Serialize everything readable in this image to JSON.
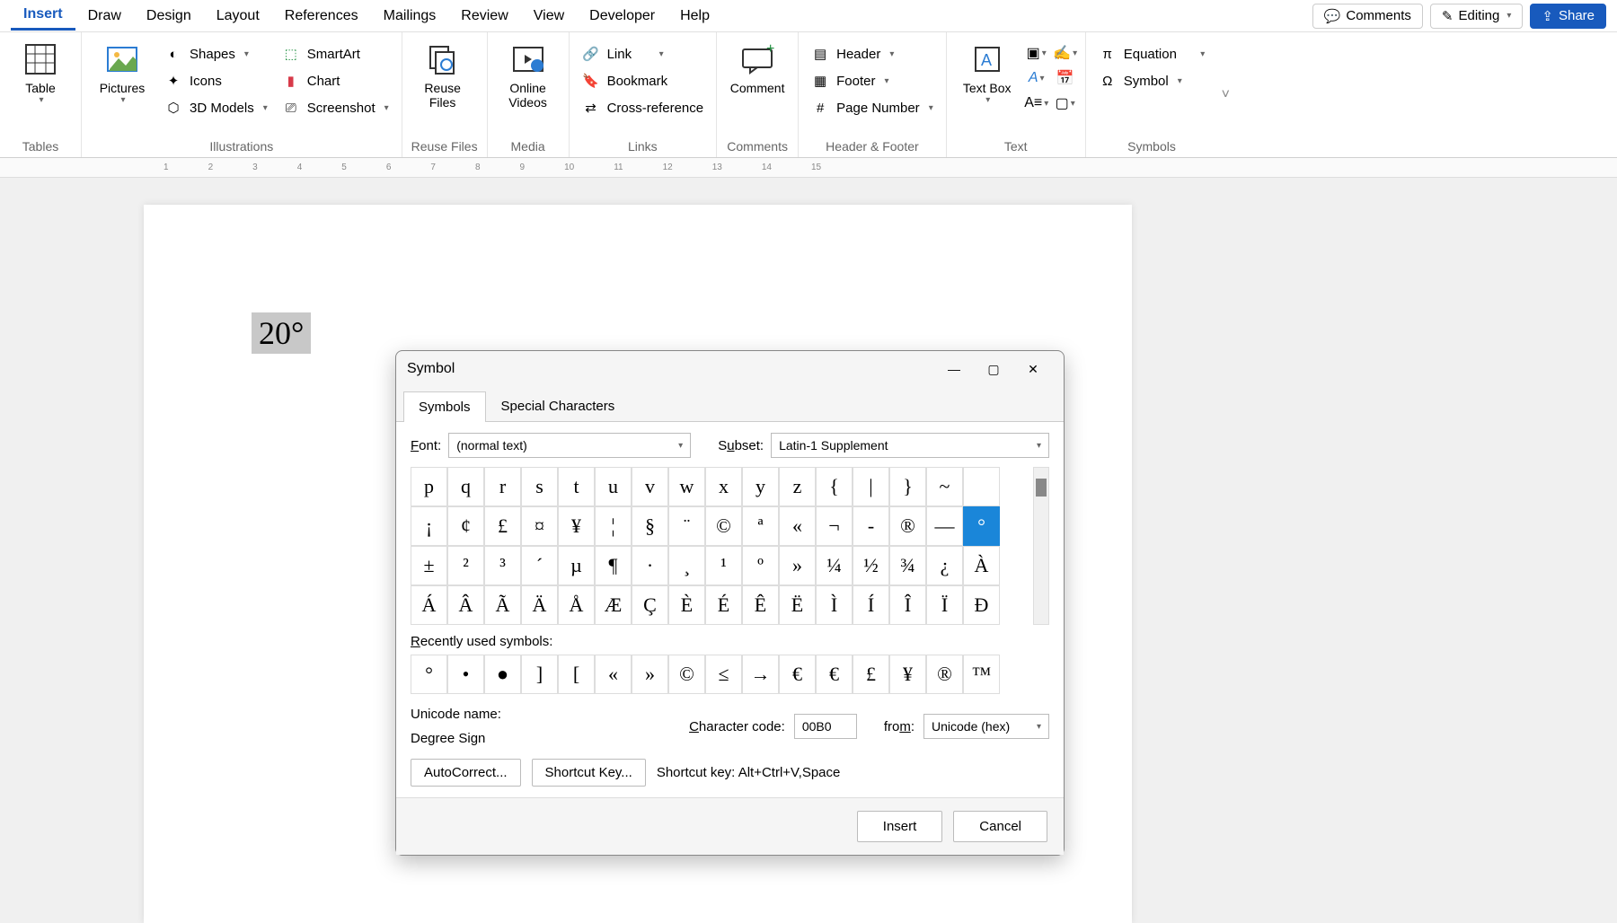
{
  "menubar": {
    "tabs": [
      "Insert",
      "Draw",
      "Design",
      "Layout",
      "References",
      "Mailings",
      "Review",
      "View",
      "Developer",
      "Help"
    ],
    "active": "Insert",
    "comments": "Comments",
    "editing": "Editing",
    "share": "Share"
  },
  "ribbon": {
    "tables": {
      "label": "Tables",
      "table": "Table"
    },
    "illustrations": {
      "label": "Illustrations",
      "pictures": "Pictures",
      "shapes": "Shapes",
      "icons": "Icons",
      "models": "3D Models",
      "smartart": "SmartArt",
      "chart": "Chart",
      "screenshot": "Screenshot"
    },
    "reuse": {
      "label": "Reuse Files",
      "btn": "Reuse Files"
    },
    "media": {
      "label": "Media",
      "btn": "Online Videos"
    },
    "links": {
      "label": "Links",
      "link": "Link",
      "bookmark": "Bookmark",
      "crossref": "Cross-reference"
    },
    "comments": {
      "label": "Comments",
      "btn": "Comment"
    },
    "headerfooter": {
      "label": "Header & Footer",
      "header": "Header",
      "footer": "Footer",
      "pagenum": "Page Number"
    },
    "text": {
      "label": "Text",
      "textbox": "Text Box"
    },
    "symbols": {
      "label": "Symbols",
      "equation": "Equation",
      "symbol": "Symbol"
    }
  },
  "document": {
    "selected_text": "20°"
  },
  "dialog": {
    "title": "Symbol",
    "tabs": {
      "symbols": "Symbols",
      "special": "Special Characters"
    },
    "font_label": "Font:",
    "font_value": "(normal text)",
    "subset_label": "Subset:",
    "subset_value": "Latin-1 Supplement",
    "grid": [
      [
        "p",
        "q",
        "r",
        "s",
        "t",
        "u",
        "v",
        "w",
        "x",
        "y",
        "z",
        "{",
        "|",
        "}",
        "~",
        ""
      ],
      [
        "¡",
        "¢",
        "£",
        "¤",
        "¥",
        "¦",
        "§",
        "¨",
        "©",
        "ª",
        "«",
        "¬",
        "-",
        "®",
        "—",
        "°"
      ],
      [
        "±",
        "²",
        "³",
        "´",
        "µ",
        "¶",
        "·",
        "¸",
        "¹",
        "º",
        "»",
        "¼",
        "½",
        "¾",
        "¿",
        "À"
      ],
      [
        "Á",
        "Â",
        "Ã",
        "Ä",
        "Å",
        "Æ",
        "Ç",
        "È",
        "É",
        "Ê",
        "Ë",
        "Ì",
        "Í",
        "Î",
        "Ï",
        "Đ"
      ]
    ],
    "selected_cell": {
      "row": 1,
      "col": 15
    },
    "recent_label": "Recently used symbols:",
    "recent": [
      "°",
      "•",
      "●",
      "]",
      "[",
      "«",
      "»",
      "©",
      "≤",
      "→",
      "€",
      "€",
      "£",
      "¥",
      "®",
      "™"
    ],
    "unicode_label": "Unicode name:",
    "unicode_name": "Degree Sign",
    "charcode_label": "Character code:",
    "charcode_value": "00B0",
    "from_label": "from:",
    "from_value": "Unicode (hex)",
    "autocorrect": "AutoCorrect...",
    "shortcutkey_btn": "Shortcut Key...",
    "shortcut_label": "Shortcut key: Alt+Ctrl+V,Space",
    "insert": "Insert",
    "cancel": "Cancel"
  }
}
